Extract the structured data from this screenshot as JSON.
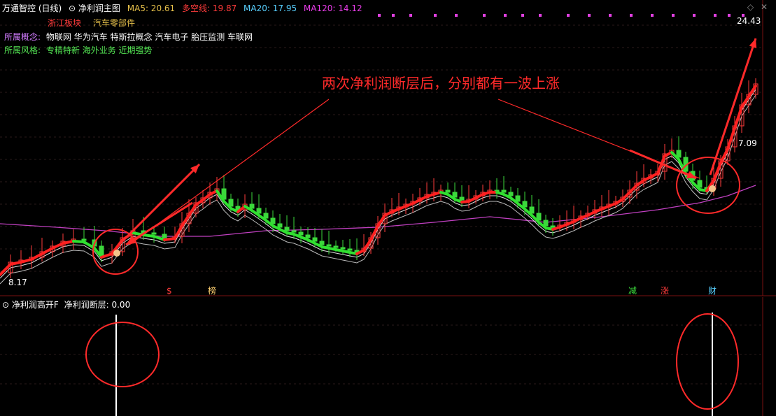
{
  "header": {
    "stock_title": "万通智控 (日线)",
    "indicator_name": "净利润主图",
    "ma5_label": "MA5: 20.61",
    "duokong_label": "多空线: 19.87",
    "ma20_label": "MA20: 17.95",
    "ma120_label": "MA120: 14.12"
  },
  "info": {
    "board": "浙江板块",
    "industry": "汽车零部件",
    "concept_label": "所属概念:",
    "concepts": "物联网 华为汽车 特斯拉概念 汽车电子 胎压监测 车联网",
    "style_label": "所属风格:",
    "styles": "专精特新 海外业务 近期强势"
  },
  "annotation": "两次净利润断层后，分别都有一波上涨",
  "price_labels": {
    "high": "24.43",
    "low": "8.17",
    "mid": "7.09"
  },
  "markers": {
    "m1": "$",
    "m2": "榜",
    "m3": "减",
    "m4": "涨",
    "m5": "财"
  },
  "sub_panel": {
    "title": "净利润高开F",
    "value_label": "净利润断层: 0.00"
  },
  "colors": {
    "up": "#ff3b3b",
    "down": "#3bd83b",
    "ma120": "#c040c0",
    "annotation": "#ff2a2a"
  },
  "chart_data": {
    "type": "line",
    "title": "万通智控 (日线)",
    "series": [
      {
        "name": "MA5",
        "values": [
          20.61
        ]
      },
      {
        "name": "多空线",
        "values": [
          19.87
        ]
      },
      {
        "name": "MA20",
        "values": [
          17.95
        ]
      },
      {
        "name": "MA120",
        "values": [
          14.12
        ]
      }
    ],
    "price_range": [
      7.09,
      24.43
    ],
    "sub_indicator": {
      "name": "净利润断层",
      "value": 0.0,
      "spikes": 2
    }
  }
}
